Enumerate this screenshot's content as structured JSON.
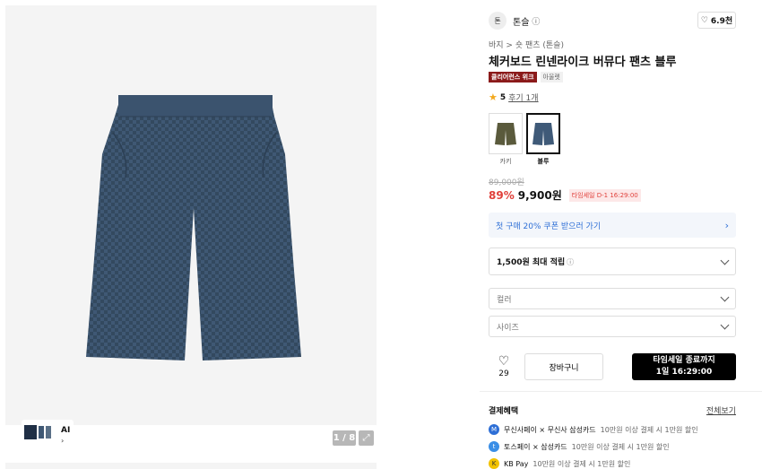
{
  "gallery": {
    "pager": "1 / 8",
    "ai_label": "AI",
    "ai_chevron": "›"
  },
  "brand": {
    "logo_text": "톤",
    "name": "톤슬",
    "info_icon": "ⓘ",
    "likes": "6.9천"
  },
  "breadcrumb": "바지 > 숏 팬츠 (톤슬)",
  "product": {
    "title": "체커보드 린넨라이크 버뮤다 팬츠 블루",
    "badge_primary": "클리어런스 위크",
    "badge_secondary": "아울렛",
    "rating": "5",
    "reviews": "후기 1개"
  },
  "options": [
    {
      "name": "카키",
      "color": "#5a5a3c",
      "selected": false
    },
    {
      "name": "블루",
      "color": "#3f5a78",
      "selected": true
    }
  ],
  "price": {
    "original": "89,000원",
    "discount": "89%",
    "final": "9,900원",
    "timer": "타임세일 D-1 16:29:00"
  },
  "coupon": {
    "text": "첫 구매 20% 쿠폰 받으러 가기"
  },
  "points": {
    "text": "1,500원 최대 적립",
    "info": "ⓘ"
  },
  "selects": {
    "color": "컬러",
    "size": "사이즈"
  },
  "actions": {
    "wish_count": "29",
    "cart": "장바구니",
    "buy_line1": "타임세일 종료까지",
    "buy_line2": "1일 16:29:00"
  },
  "benefits": {
    "title": "결제혜택",
    "view_all": "전체보기",
    "items": [
      {
        "strong": "무신사페이 × 무신사 삼성카드",
        "light": "10만원 이상 결제 시 1만원 할인",
        "color": "#2e6fd6",
        "icon": "M"
      },
      {
        "strong": "토스페이 × 삼성카드",
        "light": "10만원 이상 결제 시 1만원 할인",
        "color": "#3a8ee6",
        "icon": "t"
      },
      {
        "strong": "KB Pay",
        "light": "10만원 이상 결제 시 1만원 할인",
        "color": "#f2c200",
        "icon": "K"
      }
    ]
  }
}
